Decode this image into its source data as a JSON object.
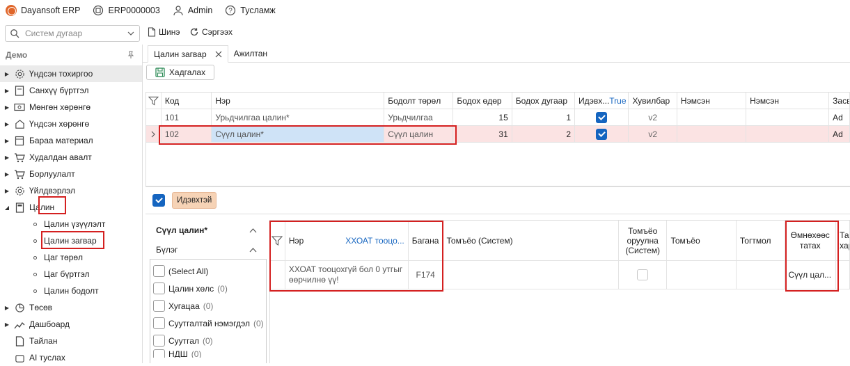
{
  "header": {
    "app_name": "Dayansoft ERP",
    "company_code": "ERP0000003",
    "user": "Admin",
    "help": "Тусламж"
  },
  "toolbar": {
    "search_placeholder": "Систем дугаар",
    "new_label": "Шинэ",
    "refresh_label": "Сэргээх"
  },
  "sidebar": {
    "title": "Демо",
    "items": [
      {
        "label": "Үндсэн тохиргоо",
        "icon": "gear-icon"
      },
      {
        "label": "Санхүү бүртгэл",
        "icon": "ledger-icon"
      },
      {
        "label": "Мөнгөн хөрөнгө",
        "icon": "money-icon"
      },
      {
        "label": "Үндсэн хөрөнгө",
        "icon": "asset-icon"
      },
      {
        "label": "Бараа материал",
        "icon": "inventory-icon"
      },
      {
        "label": "Худалдан авалт",
        "icon": "cart-icon"
      },
      {
        "label": "Борлуулалт",
        "icon": "sales-cart-icon"
      },
      {
        "label": "Үйлдвэрлэл",
        "icon": "production-gear-icon"
      },
      {
        "label": "Цалин",
        "icon": "calculator-icon"
      }
    ],
    "subitems": [
      {
        "label": "Цалин үзүүлэлт"
      },
      {
        "label": "Цалин загвар"
      },
      {
        "label": "Цаг төрөл"
      },
      {
        "label": "Цаг бүртгэл"
      },
      {
        "label": "Цалин бодолт"
      }
    ],
    "items_after": [
      {
        "label": "Төсөв",
        "icon": "budget-icon"
      },
      {
        "label": "Дашбоард",
        "icon": "dashboard-icon"
      },
      {
        "label": "Тайлан",
        "icon": "report-icon"
      },
      {
        "label": "AI туслах",
        "icon": "ai-icon"
      }
    ]
  },
  "tabs": [
    {
      "label": "Цалин загвар",
      "active": true
    },
    {
      "label": "Ажилтан",
      "active": false
    }
  ],
  "save_label": "Хадгалах",
  "grid1": {
    "columns": [
      "Код",
      "Нэр",
      "Бодолт төрөл",
      "Бодох өдөр",
      "Бодох дугаар",
      "Идэвх...",
      "Хувилбар",
      "Нэмсэн",
      "Нэмсэн",
      "Засвар"
    ],
    "filter_value": "True",
    "rows": [
      {
        "code": "101",
        "name": "Урьдчилгаа цалин*",
        "type": "Урьдчилгаа",
        "day": "15",
        "num": "1",
        "active": true,
        "ver": "v2",
        "more": "Ad"
      },
      {
        "code": "102",
        "name": "Сүүл цалин*",
        "type": "Сүүл цалин",
        "day": "31",
        "num": "2",
        "active": true,
        "ver": "v2",
        "more": "Ad"
      }
    ]
  },
  "filter_chip": "Идэвхтэй",
  "left_panel": {
    "title": "Сүүл цалин*",
    "group_label": "Бүлэг",
    "options": [
      {
        "label": "(Select All)",
        "count": ""
      },
      {
        "label": "Цалин хөлс",
        "count": "(0)"
      },
      {
        "label": "Хугацаа",
        "count": "(0)"
      },
      {
        "label": "Суутгалтай нэмэгдэл",
        "count": "(0)"
      },
      {
        "label": "Суутгал",
        "count": "(0)"
      },
      {
        "label": "НДШ",
        "count": "(0)"
      }
    ]
  },
  "grid2": {
    "columns": {
      "name": "Нэр",
      "name_filter": "ХХОАТ тооцо...",
      "column": "Багана",
      "formula_sys": "Томъёо (Систем)",
      "formula_input_l1": "Томъёо",
      "formula_input_l2": "оруулна",
      "formula_input_l3": "(Систем)",
      "formula": "Томъёо",
      "constant": "Тогтмол",
      "prev_l1": "Өмнөхөөс",
      "prev_l2": "татах",
      "next_l1": "Та",
      "next_l2": "хар"
    },
    "row": {
      "name": "ХХОАТ тооцохгүй бол 0 утгыг өөрчилнө үү!",
      "column": "F174",
      "prev": "Сүүл цал..."
    }
  }
}
